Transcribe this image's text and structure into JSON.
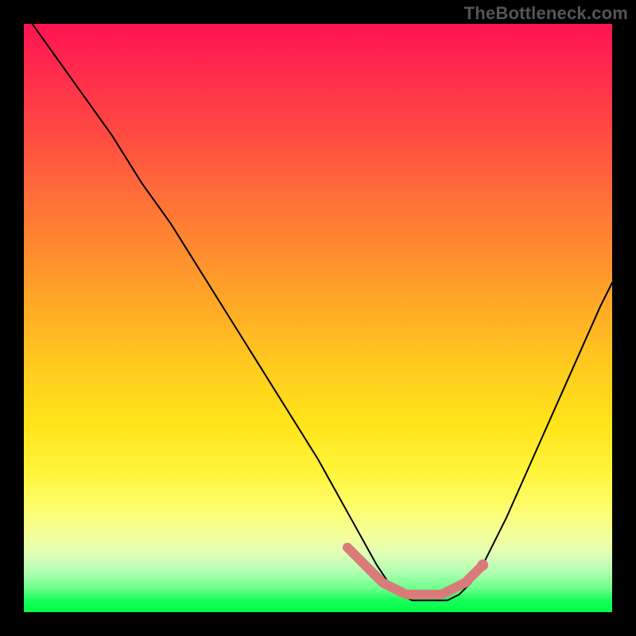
{
  "watermark": "TheBottleneck.com",
  "chart_data": {
    "type": "line",
    "title": "",
    "xlabel": "",
    "ylabel": "",
    "xlim": [
      0,
      100
    ],
    "ylim": [
      0,
      100
    ],
    "grid": false,
    "series": [
      {
        "name": "bottleneck-curve",
        "x": [
          0,
          5,
          10,
          15,
          20,
          25,
          30,
          35,
          40,
          45,
          50,
          55,
          60,
          62,
          64,
          66,
          68,
          70,
          72,
          74,
          76,
          78,
          82,
          86,
          90,
          94,
          98,
          100
        ],
        "values": [
          102,
          95,
          88,
          81,
          73,
          66,
          58,
          50,
          42,
          34,
          26,
          17,
          8,
          5,
          3,
          2,
          2,
          2,
          2,
          3,
          5,
          8,
          16,
          25,
          34,
          43,
          52,
          56
        ]
      },
      {
        "name": "highlight-band",
        "x": [
          55,
          57,
          59,
          61,
          63,
          65,
          67,
          69,
          71,
          73,
          75,
          77,
          78
        ],
        "values": [
          11,
          9,
          7,
          5,
          4,
          3,
          3,
          3,
          3,
          4,
          5,
          7,
          8
        ]
      },
      {
        "name": "highlight-marker",
        "x": [
          78
        ],
        "values": [
          8
        ]
      }
    ],
    "colors": {
      "curve": "#000000",
      "highlight": "#d97b7b",
      "marker": "#d97b7b"
    }
  }
}
